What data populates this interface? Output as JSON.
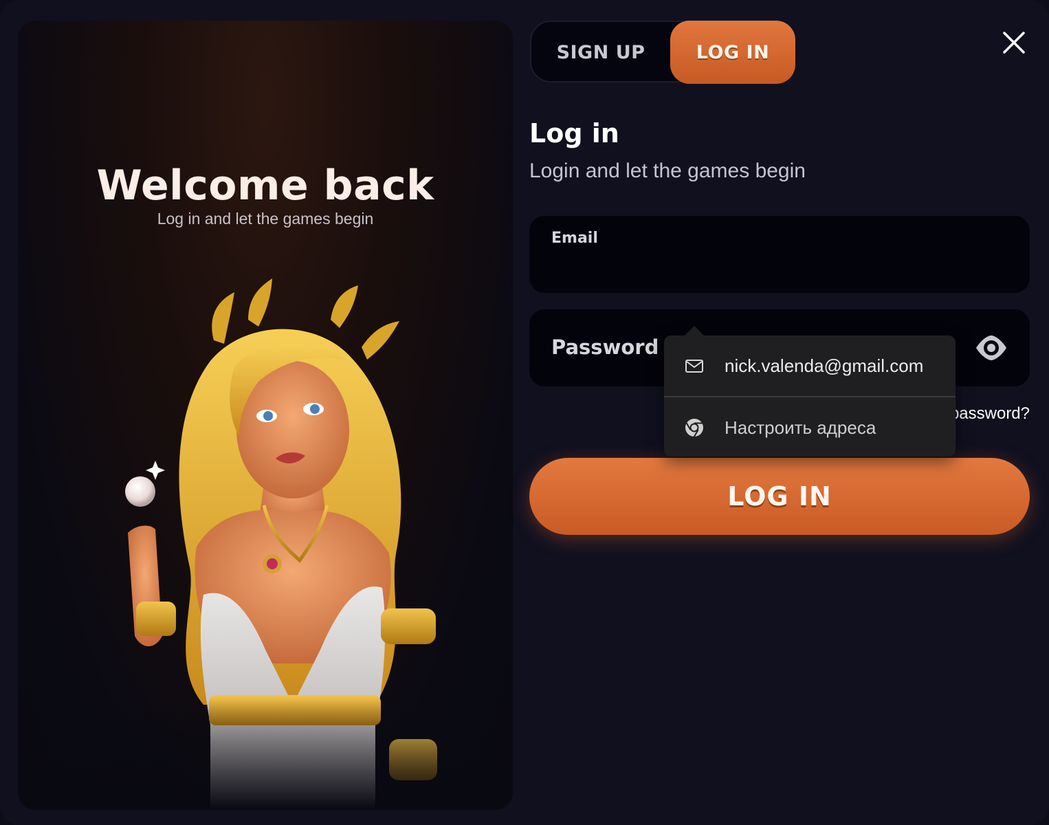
{
  "left_panel": {
    "title": "Welcome back",
    "subtitle": "Log in and let the games begin"
  },
  "tabs": [
    {
      "label": "SIGN UP",
      "active": false
    },
    {
      "label": "LOG IN",
      "active": true
    }
  ],
  "form": {
    "title": "Log in",
    "subtitle": "Login and let the games begin",
    "email_label": "Email",
    "email_value": "",
    "password_label": "Password",
    "forgot_label": "password?",
    "submit_label": "LOG IN"
  },
  "autofill": {
    "suggestion": "nick.valenda@gmail.com",
    "manage_label": "Настроить адреса"
  },
  "icons": {
    "close": "close-icon",
    "eye": "eye-icon",
    "mail": "mail-icon",
    "chrome": "chrome-icon"
  },
  "colors": {
    "accent": "#d86a30",
    "background": "#10101f",
    "field_bg": "#03030b"
  }
}
